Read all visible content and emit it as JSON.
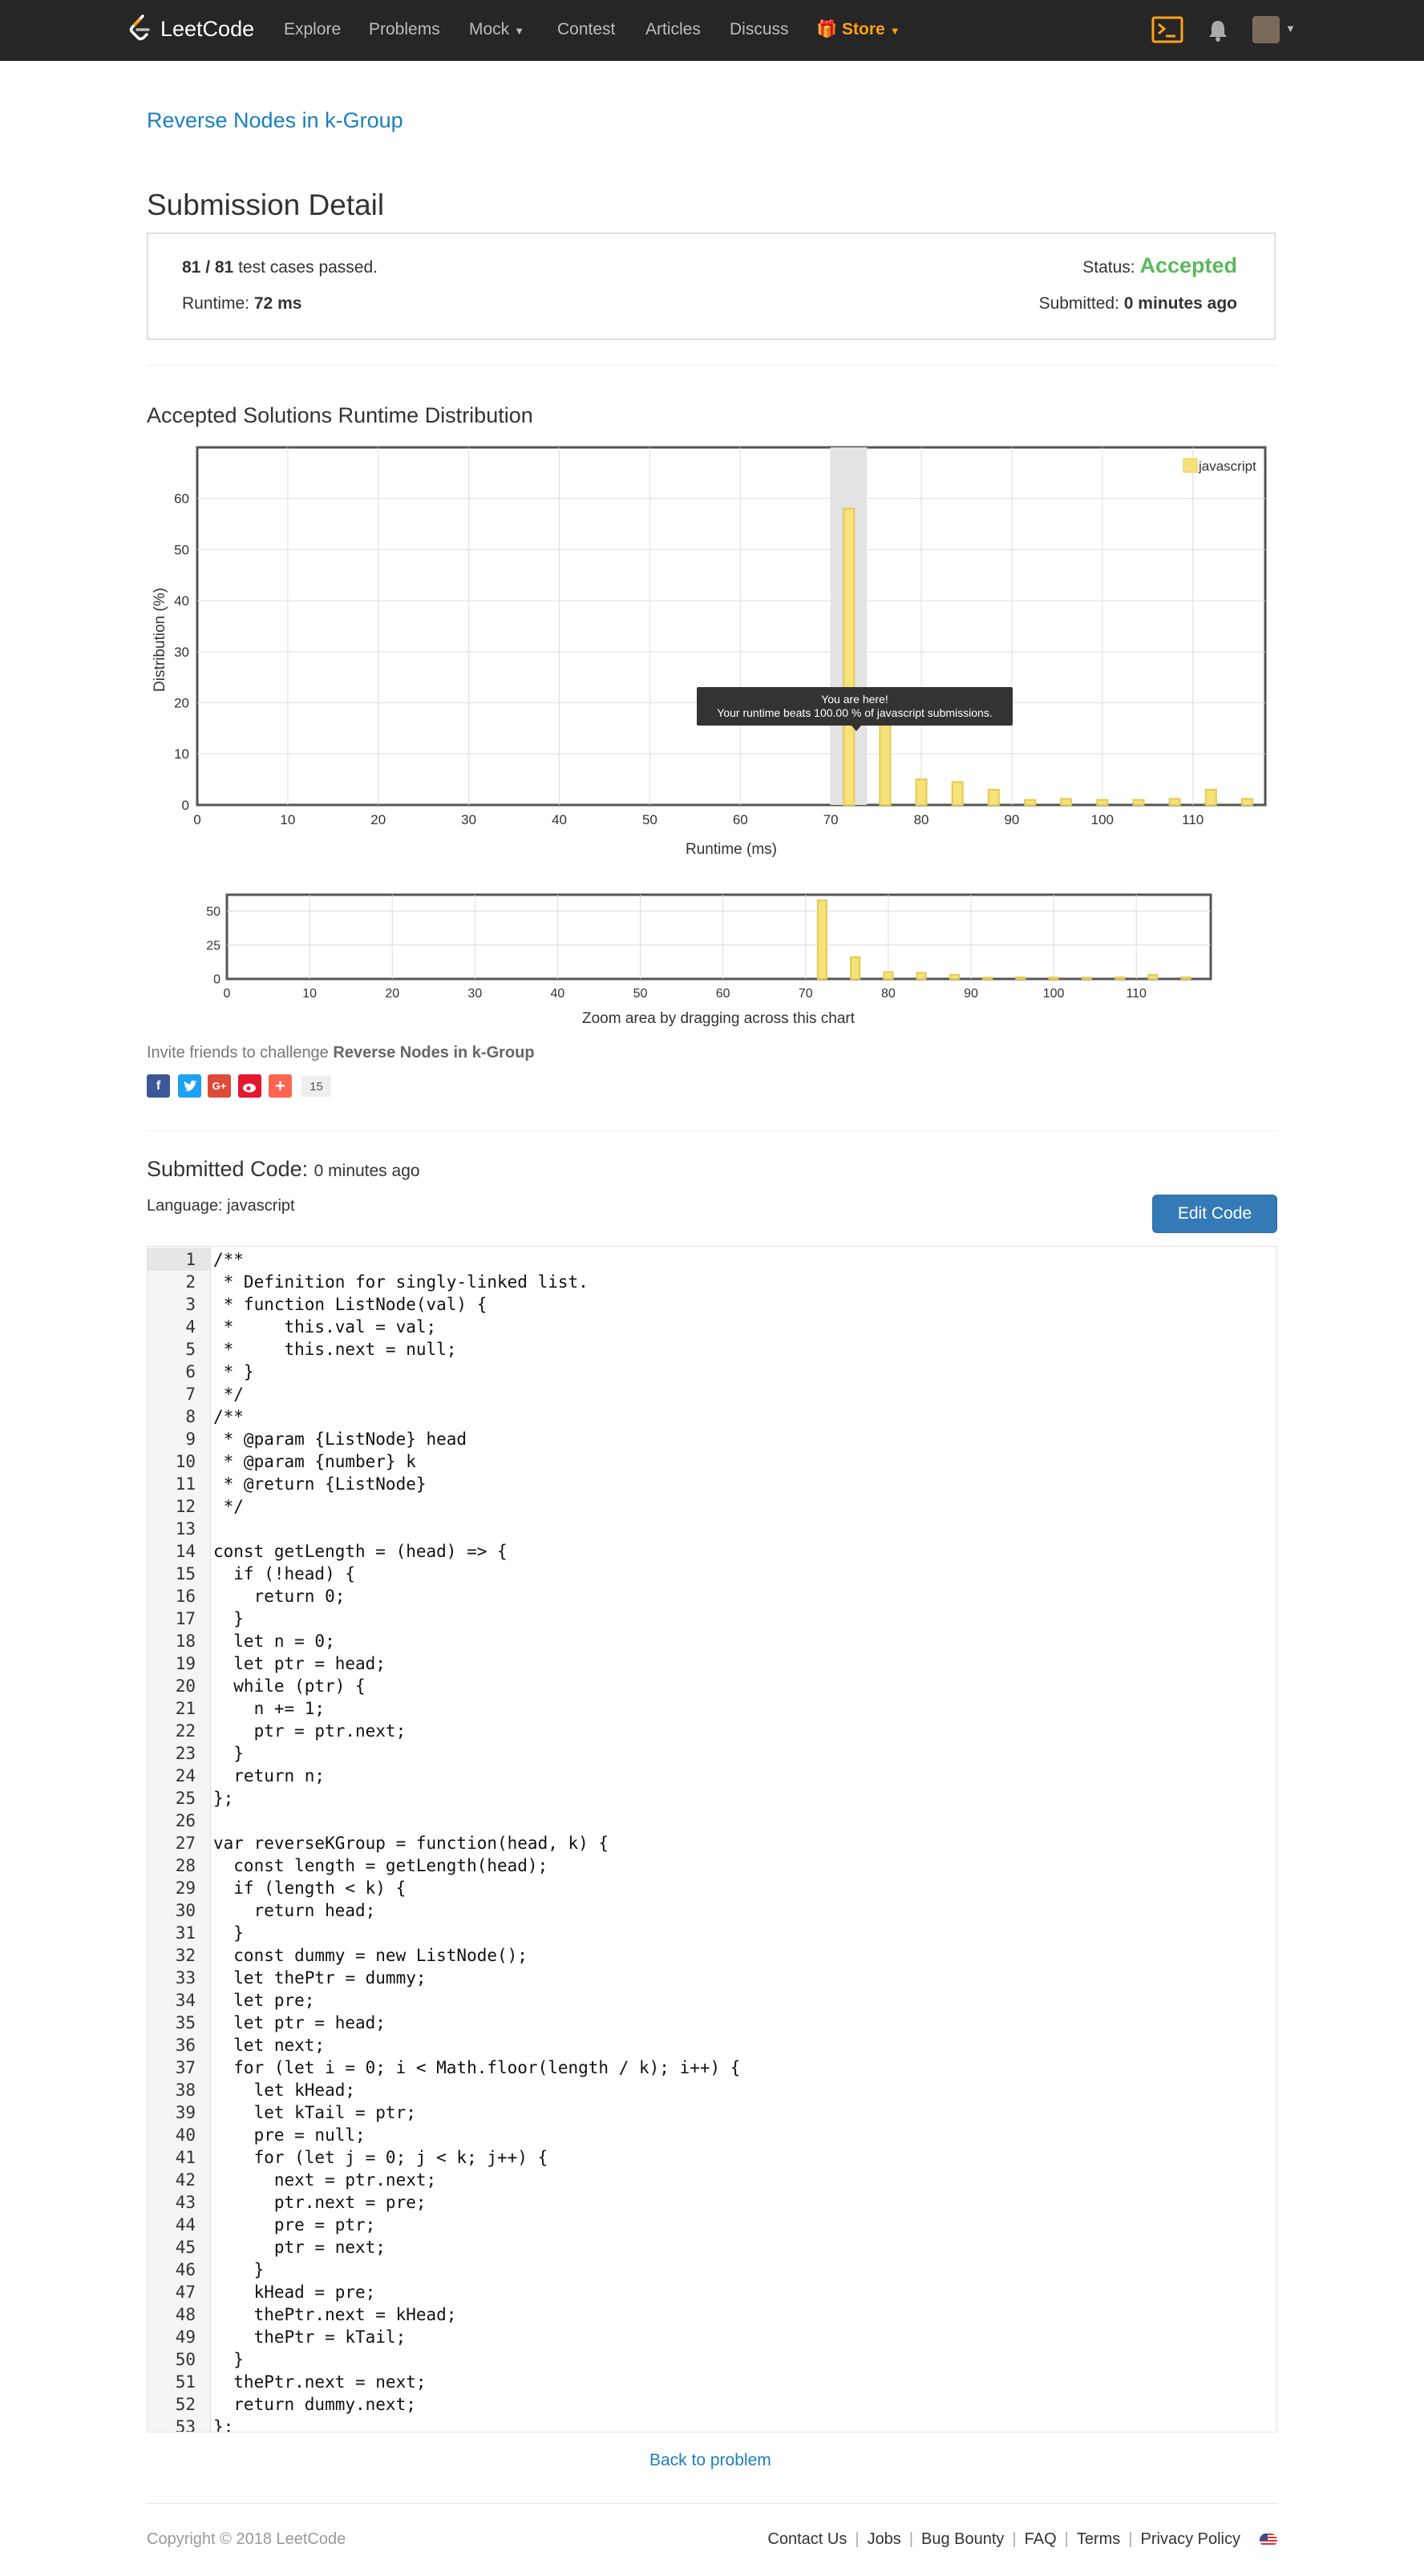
{
  "nav": {
    "logo_text": "LeetCode",
    "links": [
      "Explore",
      "Problems",
      "Mock",
      "Contest",
      "Articles",
      "Discuss"
    ],
    "store_label": "Store",
    "accent": "#ffa116"
  },
  "problem": {
    "title": "Reverse Nodes in k-Group"
  },
  "submission": {
    "heading": "Submission Detail",
    "cases_count": "81 / 81",
    "cases_suffix": " test cases passed.",
    "runtime_label": "Runtime: ",
    "runtime_value": "72 ms",
    "status_label": "Status: ",
    "status_value": "Accepted",
    "submitted_label": "Submitted: ",
    "submitted_value": "0 minutes ago"
  },
  "chart_section": {
    "heading": "Accepted Solutions Runtime Distribution",
    "tooltip_line1": "You are here!",
    "tooltip_line2": "Your runtime beats 100.00 % of javascript submissions.",
    "zoom_label": "Zoom area by dragging across this chart"
  },
  "chart_data": [
    {
      "type": "bar",
      "xlabel": "Runtime (ms)",
      "ylabel": "Distribution (%)",
      "xlim": [
        0,
        118
      ],
      "ylim": [
        0,
        70
      ],
      "xticks": [
        0,
        10,
        20,
        30,
        40,
        50,
        60,
        70,
        80,
        90,
        100,
        110
      ],
      "yticks": [
        0,
        10,
        20,
        30,
        40,
        50,
        60
      ],
      "grid": true,
      "legend_position": "top-right",
      "highlight_range": [
        70,
        74
      ],
      "series": [
        {
          "name": "javascript",
          "color": "#f5e27a",
          "x": [
            72,
            76,
            80,
            84,
            88,
            92,
            96,
            100,
            104,
            108,
            112,
            116
          ],
          "values": [
            58,
            16,
            5,
            4.5,
            3,
            1,
            1.2,
            1,
            1,
            1.2,
            3,
            1.2
          ]
        }
      ]
    },
    {
      "type": "bar",
      "xlabel": "Zoom area by dragging across this chart",
      "xlim": [
        0,
        119
      ],
      "ylim": [
        0,
        62
      ],
      "xticks": [
        0,
        10,
        20,
        30,
        40,
        50,
        60,
        70,
        80,
        90,
        100,
        110
      ],
      "yticks": [
        0,
        25,
        50
      ],
      "grid": true,
      "series": [
        {
          "color": "#f5e27a",
          "x": [
            72,
            76,
            80,
            84,
            88,
            92,
            96,
            100,
            104,
            108,
            112,
            116
          ],
          "values": [
            58,
            16,
            5,
            4.5,
            3,
            1,
            1.2,
            1,
            1,
            1.2,
            3,
            1.2
          ]
        }
      ]
    }
  ],
  "invite": {
    "prefix": "Invite friends to challenge ",
    "problem": "Reverse Nodes in k-Group",
    "share_count": "15"
  },
  "code": {
    "heading": "Submitted Code:",
    "ago": "0 minutes ago",
    "language_label": "Language: javascript",
    "edit_label": "Edit Code",
    "lines": [
      "/**",
      " * Definition for singly-linked list.",
      " * function ListNode(val) {",
      " *     this.val = val;",
      " *     this.next = null;",
      " * }",
      " */",
      "/**",
      " * @param {ListNode} head",
      " * @param {number} k",
      " * @return {ListNode}",
      " */",
      "",
      "const getLength = (head) => {",
      "  if (!head) {",
      "    return 0;",
      "  }",
      "  let n = 0;",
      "  let ptr = head;",
      "  while (ptr) {",
      "    n += 1;",
      "    ptr = ptr.next;",
      "  }",
      "  return n;",
      "};",
      "",
      "var reverseKGroup = function(head, k) {",
      "  const length = getLength(head);",
      "  if (length < k) {",
      "    return head;",
      "  }",
      "  const dummy = new ListNode();",
      "  let thePtr = dummy;",
      "  let pre;",
      "  let ptr = head;",
      "  let next;",
      "  for (let i = 0; i < Math.floor(length / k); i++) {",
      "    let kHead;",
      "    let kTail = ptr;",
      "    pre = null;",
      "    for (let j = 0; j < k; j++) {",
      "      next = ptr.next;",
      "      ptr.next = pre;",
      "      pre = ptr;",
      "      ptr = next;",
      "    }",
      "    kHead = pre;",
      "    thePtr.next = kHead;",
      "    thePtr = kTail;",
      "  }",
      "  thePtr.next = next;",
      "  return dummy.next;",
      "};"
    ]
  },
  "back_link": "Back to problem",
  "footer": {
    "copyright": "Copyright © 2018 LeetCode",
    "links": [
      "Contact Us",
      "Jobs",
      "Bug Bounty",
      "FAQ",
      "Terms",
      "Privacy Policy"
    ]
  }
}
